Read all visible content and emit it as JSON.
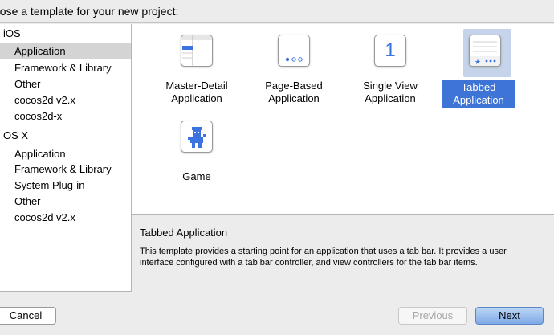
{
  "prompt": "oose a template for your new project:",
  "sidebar": {
    "sections": [
      {
        "title": "iOS",
        "items": [
          "Application",
          "Framework & Library",
          "Other",
          "cocos2d v2.x",
          "cocos2d-x"
        ]
      },
      {
        "title": "OS X",
        "items": [
          "Application",
          "Framework & Library",
          "System Plug-in",
          "Other",
          "cocos2d v2.x"
        ]
      }
    ],
    "selected": "iOS / Application"
  },
  "templates": [
    {
      "name": "Master-Detail Application",
      "line1": "Master-Detail",
      "line2": "Application",
      "icon": "master-detail-icon"
    },
    {
      "name": "Page-Based Application",
      "line1": "Page-Based",
      "line2": "Application",
      "icon": "page-based-icon"
    },
    {
      "name": "Single View Application",
      "line1": "Single View",
      "line2": "Application",
      "icon": "single-view-icon",
      "icon_glyph": "1"
    },
    {
      "name": "Tabbed Application",
      "line1": "Tabbed",
      "line2": "Application",
      "icon": "tabbed-icon",
      "selected": true
    },
    {
      "name": "Game",
      "line1": "Game",
      "line2": "",
      "icon": "game-icon"
    }
  ],
  "description": {
    "title": "Tabbed Application",
    "body": "This template provides a starting point for an application that uses a tab bar. It provides a user interface configured with a tab bar controller, and view controllers for the tab bar items."
  },
  "buttons": {
    "cancel": "Cancel",
    "previous": "Previous",
    "next": "Next"
  },
  "colors": {
    "selection_blue": "#3d74d6",
    "icon_blue": "#3b73e0",
    "sidebar_selection": "#d4d4d4"
  }
}
